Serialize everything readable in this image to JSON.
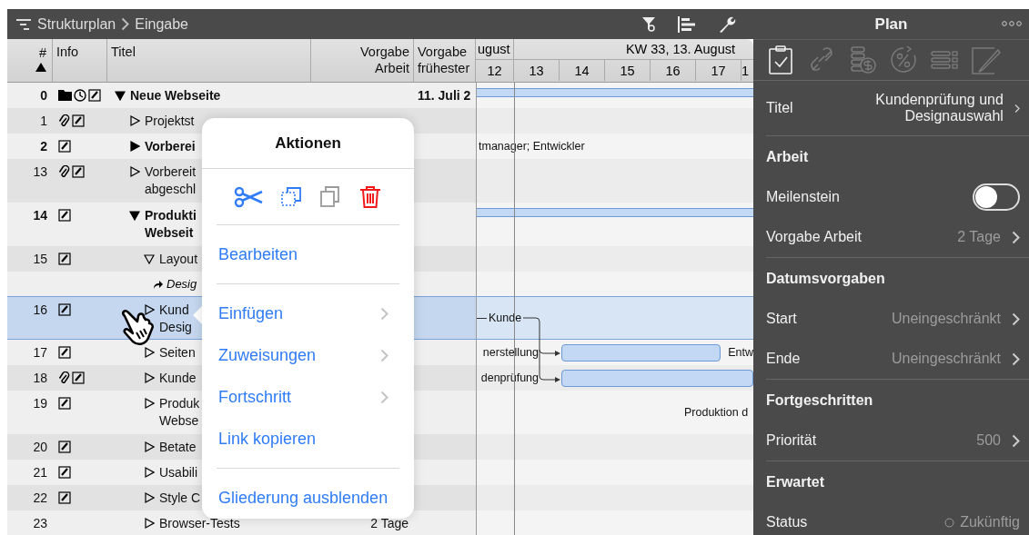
{
  "toolbar": {
    "breadcrumb": [
      {
        "label": "Strukturplan"
      },
      {
        "label": "Eingabe"
      }
    ]
  },
  "table": {
    "columns": [
      {
        "label": [
          "#"
        ],
        "sorted": true
      },
      {
        "label": [
          "Info"
        ],
        "sorted": false
      },
      {
        "label": [
          "Titel"
        ],
        "sorted": false
      },
      {
        "label": [
          "Vorgabe",
          "Arbeit"
        ],
        "sorted": false
      },
      {
        "label": [
          "Vorgabe",
          "frühester"
        ],
        "sorted": false
      }
    ],
    "timeline": {
      "weeks": [
        "ugust",
        "KW 33, 13. August"
      ],
      "days": [
        "12",
        "13",
        "14",
        "15",
        "16",
        "17",
        "1"
      ]
    },
    "rows": [
      {
        "number": "0",
        "summary": true,
        "expanded": true,
        "selected": false,
        "info": [
          {
            "kind": "folder"
          },
          {
            "kind": "clock"
          },
          {
            "kind": "note"
          }
        ],
        "title": [
          "Neue Webseite"
        ],
        "start": "11. Juli 2",
        "gantt": {
          "kind": "summary"
        },
        "children": [
          {
            "number": "1",
            "summary": false,
            "expanded": false,
            "selected": false,
            "info": [
              {
                "kind": "attachment"
              },
              {
                "kind": "note"
              }
            ],
            "title": [
              "Projektst"
            ]
          },
          {
            "number": "2",
            "summary": true,
            "expanded": false,
            "selected": false,
            "info": [
              {
                "kind": "note"
              }
            ],
            "title": [
              "Vorberei"
            ],
            "gantt": {
              "kind": "label",
              "text": "tmanager; Entwickler"
            }
          },
          {
            "number": "13",
            "summary": false,
            "expanded": false,
            "selected": false,
            "info": [
              {
                "kind": "attachment"
              },
              {
                "kind": "note"
              }
            ],
            "title": [
              "Vorbereit",
              "abgeschl"
            ]
          },
          {
            "number": "14",
            "summary": true,
            "expanded": true,
            "selected": false,
            "info": [
              {
                "kind": "note"
              }
            ],
            "title": [
              "Produkti",
              "Webseit"
            ],
            "gantt": {
              "kind": "summary"
            },
            "children": [
              {
                "number": "15",
                "summary": false,
                "expanded": true,
                "selected": false,
                "info": [
                  {
                    "kind": "note"
                  }
                ],
                "title": [
                  "Layout"
                ],
                "note": "Desig"
              },
              {
                "number": "16",
                "summary": false,
                "expanded": false,
                "selected": true,
                "info": [
                  {
                    "kind": "note"
                  }
                ],
                "title": [
                  "Kund",
                  "Desig"
                ],
                "gantt": {
                  "kind": "milestone",
                  "text": "Kunde"
                }
              },
              {
                "number": "17",
                "summary": false,
                "expanded": false,
                "selected": false,
                "info": [
                  {
                    "kind": "note"
                  }
                ],
                "title": [
                  "Seiten"
                ],
                "gantt": {
                  "kind": "task",
                  "left": "nerstellung",
                  "right": "Entw"
                }
              },
              {
                "number": "18",
                "summary": false,
                "expanded": false,
                "selected": false,
                "info": [
                  {
                    "kind": "attachment"
                  },
                  {
                    "kind": "note"
                  }
                ],
                "title": [
                  "Kunde"
                ],
                "gantt": {
                  "kind": "task",
                  "left": "denprüfung"
                }
              },
              {
                "number": "19",
                "summary": false,
                "expanded": false,
                "selected": false,
                "info": [
                  {
                    "kind": "note"
                  }
                ],
                "title": [
                  "Produk",
                  "Webse"
                ],
                "gantt": {
                  "kind": "late-label",
                  "text": "Produktion d"
                }
              },
              {
                "number": "20",
                "summary": false,
                "expanded": false,
                "selected": false,
                "info": [
                  {
                    "kind": "note"
                  }
                ],
                "title": [
                  "Betate"
                ]
              },
              {
                "number": "21",
                "summary": false,
                "expanded": false,
                "selected": false,
                "info": [
                  {
                    "kind": "note"
                  }
                ],
                "title": [
                  "Usabili"
                ]
              },
              {
                "number": "22",
                "summary": false,
                "expanded": false,
                "selected": false,
                "info": [
                  {
                    "kind": "note"
                  }
                ],
                "title": [
                  "Style C"
                ]
              },
              {
                "number": "23",
                "summary": false,
                "expanded": false,
                "selected": false,
                "title": [
                  "Browser-Tests"
                ],
                "work": "2 Tage"
              }
            ]
          }
        ]
      }
    ]
  },
  "actions_popover": {
    "title": "Aktionen",
    "tools": [
      {
        "kind": "cut",
        "disabled": false
      },
      {
        "kind": "duplicate",
        "disabled": false
      },
      {
        "kind": "copy",
        "disabled": true
      },
      {
        "kind": "delete",
        "disabled": false
      }
    ],
    "sections": [
      [
        {
          "label": "Bearbeiten",
          "submenu": false
        }
      ],
      [
        {
          "label": "Einfügen",
          "submenu": true
        },
        {
          "label": "Zuweisungen",
          "submenu": true
        },
        {
          "label": "Fortschritt",
          "submenu": true
        },
        {
          "label": "Link kopieren",
          "submenu": false
        }
      ],
      [
        {
          "label": "Gliederung ausblenden",
          "submenu": false
        }
      ]
    ]
  },
  "inspector": {
    "title": "Plan",
    "tabs": [
      {
        "kind": "task",
        "selected": true
      },
      {
        "kind": "links",
        "selected": false
      },
      {
        "kind": "costs",
        "selected": false
      },
      {
        "kind": "progress",
        "selected": false
      },
      {
        "kind": "list",
        "selected": false
      },
      {
        "kind": "notes",
        "selected": false
      }
    ],
    "sections": [
      {
        "rows": [
          {
            "kind": "value",
            "label": "Titel",
            "value": "Kundenprüfung und Designauswahl"
          }
        ]
      },
      {
        "header": "Arbeit",
        "rows": [
          {
            "kind": "toggle",
            "label": "Meilenstein",
            "on": false
          },
          {
            "kind": "value",
            "label": "Vorgabe Arbeit",
            "value": "2 Tage"
          }
        ]
      },
      {
        "header": "Datumsvorgaben",
        "rows": [
          {
            "kind": "value",
            "label": "Start",
            "value": "Uneingeschränkt"
          },
          {
            "kind": "value",
            "label": "Ende",
            "value": "Uneingeschränkt"
          }
        ]
      },
      {
        "header": "Fortgeschritten",
        "rows": [
          {
            "kind": "value",
            "label": "Priorität",
            "value": "500"
          }
        ]
      },
      {
        "header": "Erwartet",
        "rows": [
          {
            "kind": "status",
            "label": "Status",
            "value": "Zukünftig"
          }
        ]
      }
    ]
  }
}
